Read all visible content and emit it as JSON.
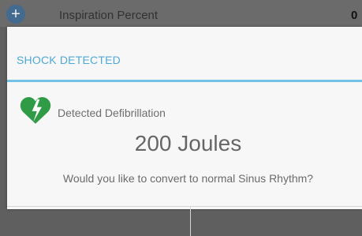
{
  "background": {
    "row_label": "Inspiration Percent",
    "row_value": "0",
    "add_icon": "plus-circle-icon"
  },
  "dialog": {
    "title": "SHOCK DETECTED",
    "icon": "heart-lightning-icon",
    "detected_label": "Detected Defibrillation",
    "energy": "200 Joules",
    "question": "Would you like to convert to normal Sinus Rhythm?",
    "buttons": [
      "",
      ""
    ]
  },
  "colors": {
    "accent": "#4fa9d6",
    "divider": "#72c1e6",
    "heart": "#2f9b47"
  }
}
